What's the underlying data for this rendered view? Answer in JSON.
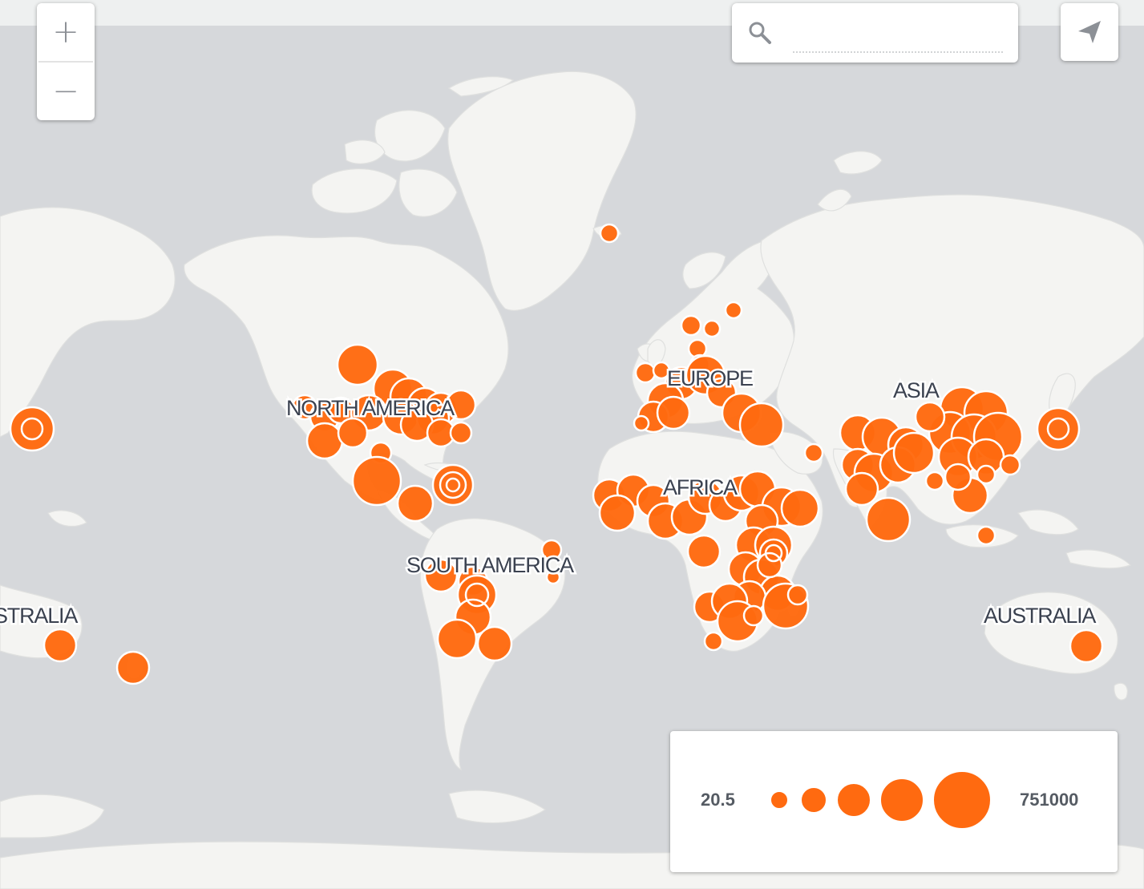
{
  "map": {
    "continent_labels": [
      "NORTH AMERICA",
      "EUROPE",
      "ASIA",
      "AFRICA",
      "SOUTH AMERICA",
      "AUSTRALIA",
      "STRALIA"
    ],
    "colors": {
      "ocean": "#d6d8db",
      "land": "#f4f4f2",
      "bubble": "#ff6a10",
      "label": "#3b4250"
    }
  },
  "controls": {
    "zoom_in": "+",
    "zoom_out": "−",
    "search_placeholder": "",
    "search_value": "",
    "search_icon": "search-icon",
    "locate_icon": "navigation-arrow-icon"
  },
  "legend": {
    "min_label": "20.5",
    "max_label": "751000",
    "steps": 5
  }
}
